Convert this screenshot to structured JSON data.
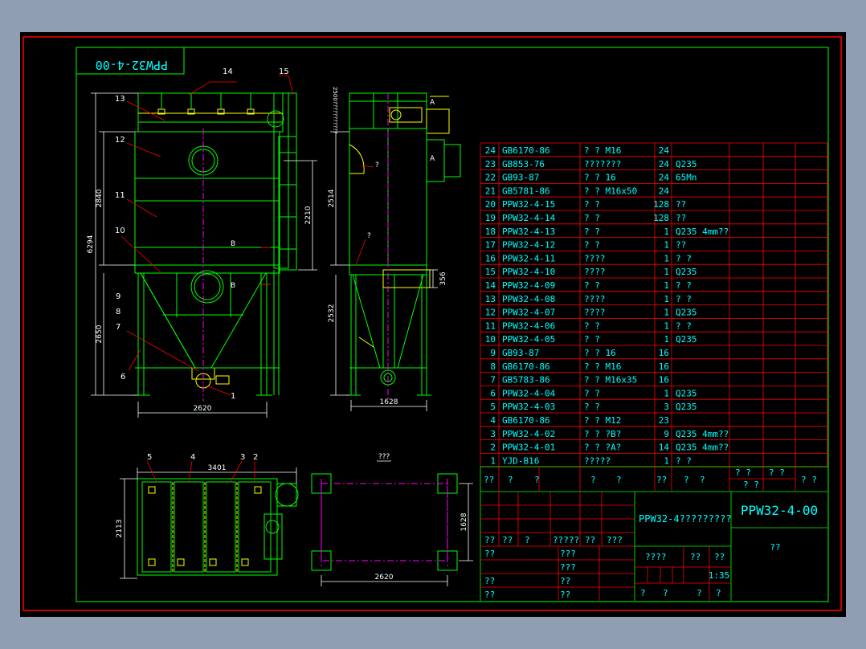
{
  "drawing_number_mirrored": "PPW32-4-00",
  "title_block": {
    "drawing_name": "PPW32-4?????????",
    "drawing_number": "PPW32-4-00",
    "scale": "1:35",
    "unknown": "??",
    "row_labels": [
      "??",
      "??",
      "?",
      "?????",
      "??",
      "???",
      "???"
    ],
    "left_labels": [
      "??",
      "??",
      "??"
    ],
    "mid_labels": [
      "???",
      "??",
      "??"
    ],
    "weight_label": "????",
    "weight_labels": [
      "??",
      "??"
    ],
    "sheet_labels": [
      "?",
      "?",
      "?",
      "?"
    ],
    "header_labels": [
      "??",
      "?",
      "?",
      "?",
      "?",
      "??",
      "?",
      "?"
    ],
    "header_right": [
      "? ?",
      "? ?",
      "? ?",
      "? ?"
    ]
  },
  "bom": [
    {
      "no": "24",
      "code": "GB6170-86",
      "name": "?  ? M16",
      "qty": "24",
      "mat": ""
    },
    {
      "no": "23",
      "code": "GB853-76",
      "name": "???????",
      "qty": "24",
      "mat": "Q235"
    },
    {
      "no": "22",
      "code": "GB93-87",
      "name": "?  ? 16",
      "qty": "24",
      "mat": "65Mn"
    },
    {
      "no": "21",
      "code": "GB5781-86",
      "name": "?  ? M16x50",
      "qty": "24",
      "mat": ""
    },
    {
      "no": "20",
      "code": "PPW32-4-15",
      "name": "?  ?",
      "qty": "128",
      "mat": "??"
    },
    {
      "no": "19",
      "code": "PPW32-4-14",
      "name": "?  ?",
      "qty": "128",
      "mat": "??"
    },
    {
      "no": "18",
      "code": "PPW32-4-13",
      "name": "?  ?",
      "qty": "1",
      "mat": "Q235 4mm??"
    },
    {
      "no": "17",
      "code": "PPW32-4-12",
      "name": "?  ?",
      "qty": "1",
      "mat": "??"
    },
    {
      "no": "16",
      "code": "PPW32-4-11",
      "name": "????",
      "qty": "1",
      "mat": "? ?"
    },
    {
      "no": "15",
      "code": "PPW32-4-10",
      "name": "????",
      "qty": "1",
      "mat": "Q235"
    },
    {
      "no": "14",
      "code": "PPW32-4-09",
      "name": "?  ?",
      "qty": "1",
      "mat": "? ?"
    },
    {
      "no": "13",
      "code": "PPW32-4-08",
      "name": "????",
      "qty": "1",
      "mat": "? ?"
    },
    {
      "no": "12",
      "code": "PPW32-4-07",
      "name": "????",
      "qty": "1",
      "mat": "Q235"
    },
    {
      "no": "11",
      "code": "PPW32-4-06",
      "name": "?  ?",
      "qty": "1",
      "mat": "? ?"
    },
    {
      "no": "10",
      "code": "PPW32-4-05",
      "name": "?  ?",
      "qty": "1",
      "mat": "Q235"
    },
    {
      "no": "9",
      "code": "GB93-87",
      "name": "?  ? 16",
      "qty": "16",
      "mat": ""
    },
    {
      "no": "8",
      "code": "GB6170-86",
      "name": "?  ? M16",
      "qty": "16",
      "mat": ""
    },
    {
      "no": "7",
      "code": "GB5783-86",
      "name": "?  ? M16x35",
      "qty": "16",
      "mat": ""
    },
    {
      "no": "6",
      "code": "PPW32-4-04",
      "name": "?  ?",
      "qty": "1",
      "mat": "Q235"
    },
    {
      "no": "5",
      "code": "PPW32-4-03",
      "name": "? ?",
      "qty": "3",
      "mat": "Q235"
    },
    {
      "no": "4",
      "code": "GB6170-86",
      "name": "?  ? M12",
      "qty": "23",
      "mat": ""
    },
    {
      "no": "3",
      "code": "PPW32-4-02",
      "name": "?  ? ?B?",
      "qty": "9",
      "mat": "Q235 4mm??"
    },
    {
      "no": "2",
      "code": "PPW32-4-01",
      "name": "?  ? ?A?",
      "qty": "14",
      "mat": "Q235 4mm??"
    },
    {
      "no": "1",
      "code": "YJD-B16",
      "name": "?????",
      "qty": "1",
      "mat": "?  ?"
    }
  ],
  "front_view": {
    "balloons": [
      "14",
      "15",
      "13",
      "12",
      "11",
      "10",
      "9",
      "8",
      "7",
      "6",
      "1"
    ],
    "dims": {
      "total_height": "6294",
      "upper": "2840",
      "lower": "2650",
      "width": "2620",
      "inner": "2210"
    },
    "section_marks": [
      "B",
      "B"
    ]
  },
  "side_view": {
    "dims": {
      "h1": "2514",
      "h2": "2532",
      "w": "1628",
      "inlet": "356"
    },
    "vertical_note": "2500???????????",
    "marks": [
      "A",
      "A",
      "?",
      "?"
    ]
  },
  "plan_view": {
    "balloons": [
      "5",
      "4",
      "3",
      "2"
    ],
    "dims": {
      "width": "3401",
      "depth": "2113"
    }
  },
  "foundation_view": {
    "label": "???",
    "dims": {
      "width": "2620",
      "depth": "1628"
    }
  },
  "colors": {
    "frame": "#ff0000",
    "line": "#00ff00",
    "text": "#00ffff",
    "dim": "#ffffff",
    "yellow": "#ffff00",
    "magenta": "#ff00ff"
  }
}
